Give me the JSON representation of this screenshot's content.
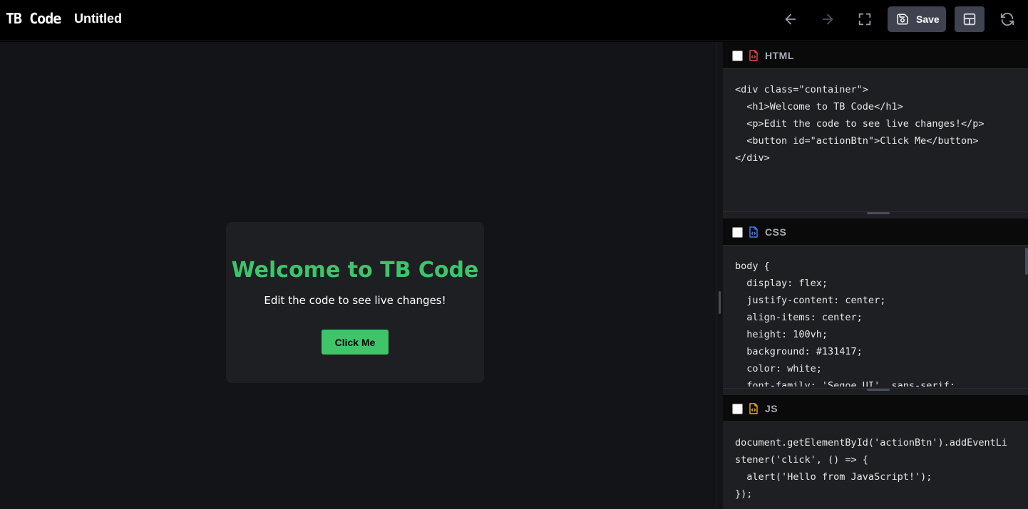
{
  "app": {
    "brand": "TB Code",
    "document_title": "Untitled"
  },
  "toolbar": {
    "back_icon": "arrow-left-icon",
    "forward_icon": "arrow-right-icon",
    "fullscreen_icon": "fullscreen-icon",
    "save_label": "Save",
    "save_icon": "floppy-disk-icon",
    "layout_icon": "layout-icon",
    "refresh_icon": "refresh-icon"
  },
  "preview": {
    "heading": "Welcome to TB Code",
    "paragraph": "Edit the code to see live changes!",
    "button_label": "Click Me",
    "colors": {
      "accent": "#3fc46a",
      "background": "#131417",
      "card": "#1e1f23"
    }
  },
  "editors": {
    "html": {
      "label": "HTML",
      "icon_color": "#e5484d",
      "code": "<div class=\"container\">\n  <h1>Welcome to TB Code</h1>\n  <p>Edit the code to see live changes!</p>\n  <button id=\"actionBtn\">Click Me</button>\n</div>"
    },
    "css": {
      "label": "CSS",
      "icon_color": "#3b82f6",
      "code": "body {\n  display: flex;\n  justify-content: center;\n  align-items: center;\n  height: 100vh;\n  background: #131417;\n  color: white;\n  font-family: 'Segoe UI', sans-serif;"
    },
    "js": {
      "label": "JS",
      "icon_color": "#eab308",
      "code": "document.getElementById('actionBtn').addEventLi\nstener('click', () => {\n  alert('Hello from JavaScript!');\n});"
    }
  }
}
